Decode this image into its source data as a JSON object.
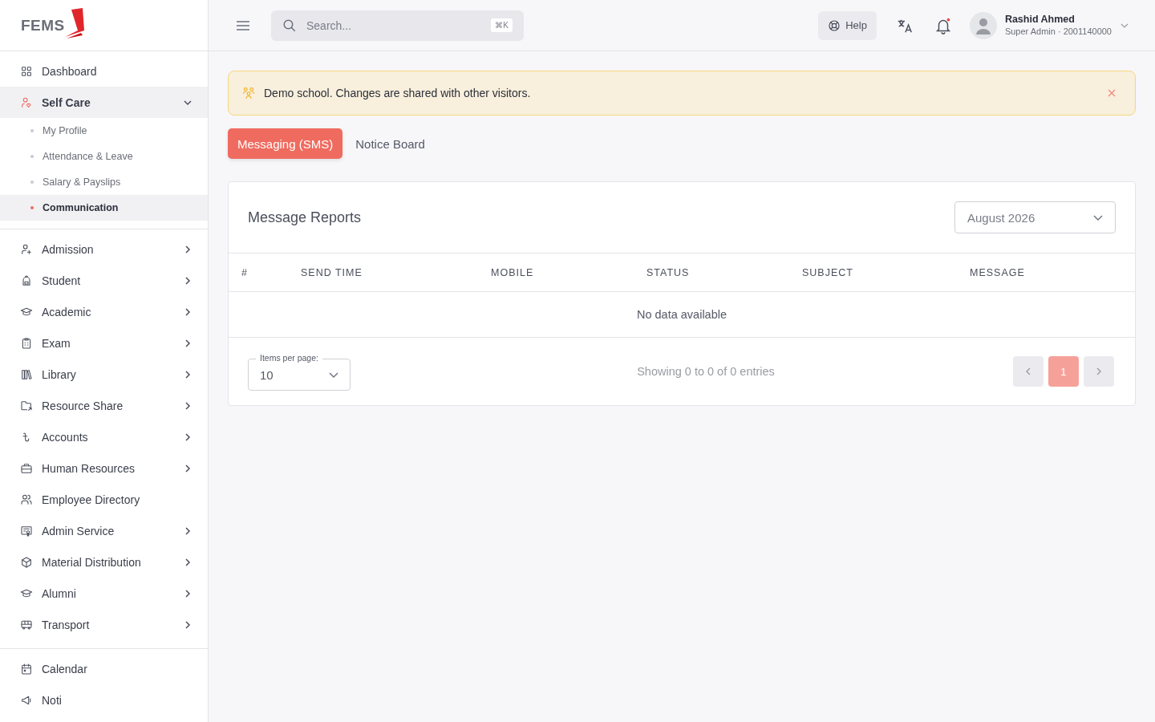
{
  "logo": {
    "text": "FEMS"
  },
  "sidebar": {
    "sections": [
      [
        {
          "label": "Dashboard",
          "kind": "link",
          "selected": false
        },
        {
          "label": "Self Care",
          "kind": "group",
          "expanded": true,
          "selected": true,
          "children": [
            {
              "label": "My Profile",
              "selected": false
            },
            {
              "label": "Attendance & Leave",
              "selected": false
            },
            {
              "label": "Salary & Payslips",
              "selected": false
            },
            {
              "label": "Communication",
              "selected": true
            }
          ]
        }
      ],
      [
        {
          "label": "Admission",
          "kind": "group",
          "expanded": false,
          "selected": false
        },
        {
          "label": "Student",
          "kind": "group",
          "expanded": false,
          "selected": false
        },
        {
          "label": "Academic",
          "kind": "group",
          "expanded": false,
          "selected": false
        },
        {
          "label": "Exam",
          "kind": "group",
          "expanded": false,
          "selected": false
        },
        {
          "label": "Library",
          "kind": "group",
          "expanded": false,
          "selected": false
        },
        {
          "label": "Resource Share",
          "kind": "group",
          "expanded": false,
          "selected": false
        },
        {
          "label": "Accounts",
          "kind": "group",
          "expanded": false,
          "selected": false
        },
        {
          "label": "Human Resources",
          "kind": "group",
          "expanded": false,
          "selected": false
        },
        {
          "label": "Employee Directory",
          "kind": "link",
          "selected": false
        },
        {
          "label": "Admin Service",
          "kind": "group",
          "expanded": false,
          "selected": false
        },
        {
          "label": "Material Distribution",
          "kind": "group",
          "expanded": false,
          "selected": false
        },
        {
          "label": "Alumni",
          "kind": "group",
          "expanded": false,
          "selected": false
        },
        {
          "label": "Transport",
          "kind": "group",
          "expanded": false,
          "selected": false
        }
      ],
      [
        {
          "label": "Calendar",
          "kind": "link",
          "selected": false
        },
        {
          "label": "Noti",
          "kind": "link",
          "selected": false
        }
      ]
    ]
  },
  "topbar": {
    "search": {
      "placeholder": "Search...",
      "shortcut": "⌘K"
    },
    "help": "Help",
    "notification_dot": true,
    "user": {
      "name": "Rashid Ahmed",
      "role": "Super Admin · 2001140000"
    }
  },
  "alert": {
    "text": "Demo school. Changes are shared with other visitors."
  },
  "tabs": [
    {
      "label": "Messaging (SMS)",
      "selected": true
    },
    {
      "label": "Notice Board",
      "selected": false
    }
  ],
  "card": {
    "title": "Message Reports",
    "month": {
      "value": "August 2026"
    },
    "table": {
      "columns": [
        "#",
        "SEND TIME",
        "MOBILE",
        "STATUS",
        "SUBJECT",
        "MESSAGE"
      ],
      "empty": "No data available"
    },
    "footer": {
      "per_page": {
        "label": "Items per page:",
        "value": "10"
      },
      "summary": "Showing 0 to 0 of 0 entries",
      "pages": [
        {
          "label": "1",
          "selected": true
        }
      ]
    }
  }
}
